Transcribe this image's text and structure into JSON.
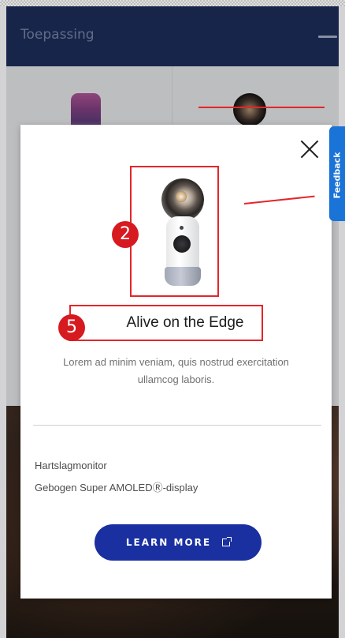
{
  "app_bar": {
    "title": "Toepassing"
  },
  "modal": {
    "title": "Alive on the Edge",
    "description": "Lorem ad minim veniam, quis nostrud exercitation ullamcog laboris.",
    "features": [
      "Hartslagmonitor",
      "Gebogen Super AMOLEDⓇ-display"
    ],
    "cta_label": "LEARN MORE"
  },
  "annotations": {
    "product_image_marker": "2",
    "title_marker": "5"
  },
  "feedback_tab": {
    "label": "Feedback"
  },
  "colors": {
    "app_bar": "#1c2b55",
    "cta": "#1a2fa0",
    "marker": "#d71920",
    "feedback": "#1a73d6"
  }
}
